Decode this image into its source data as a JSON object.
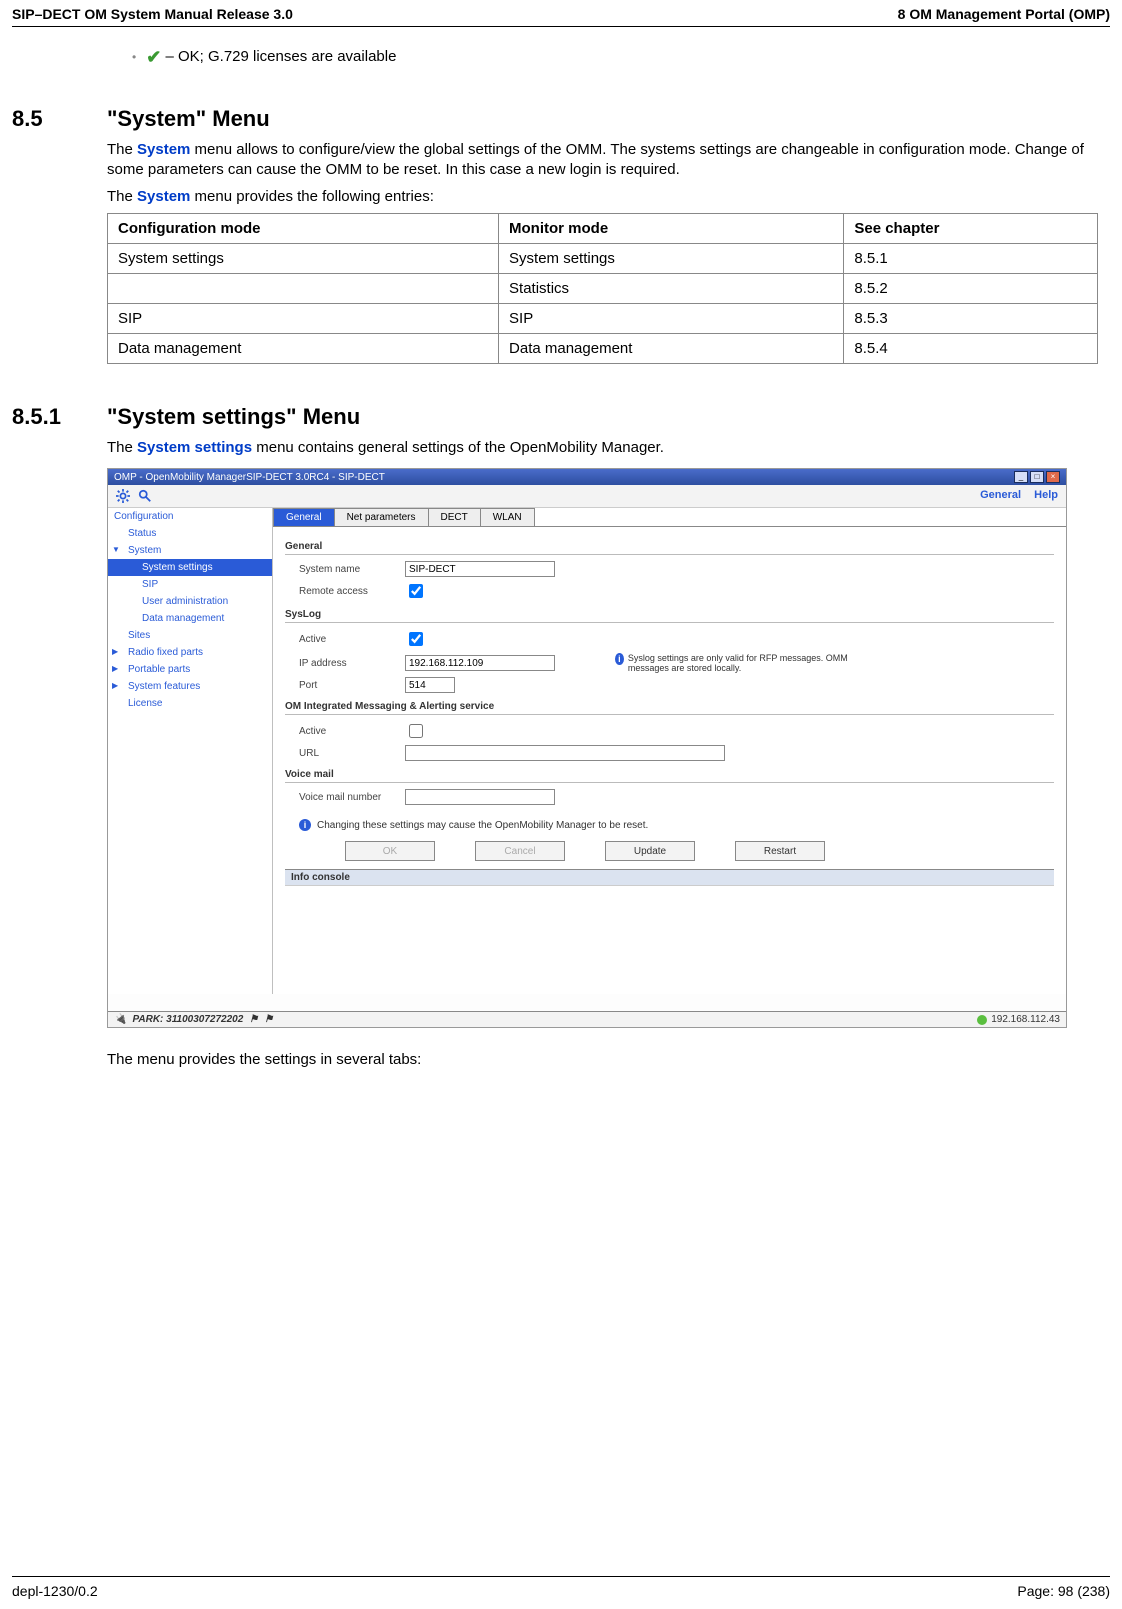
{
  "header": {
    "left": "SIP–DECT OM System Manual Release 3.0",
    "right": "8 OM Management Portal (OMP)"
  },
  "bullet": {
    "text": " – OK; G.729 licenses are available"
  },
  "sec85": {
    "num": "8.5",
    "title": "\"System\" Menu",
    "para1a": "The ",
    "para1b": "System",
    "para1c": " menu allows to configure/view the global settings of the OMM. The systems settings are changeable in configuration mode. Change of some parameters can cause the OMM to be reset. In this case a new login is required.",
    "para2a": "The ",
    "para2b": "System",
    "para2c": " menu provides the following entries:"
  },
  "table": {
    "head": [
      "Configuration mode",
      "Monitor mode",
      "See chapter"
    ],
    "rows": [
      [
        "System settings",
        "System settings",
        "8.5.1"
      ],
      [
        "",
        "Statistics",
        "8.5.2"
      ],
      [
        "SIP",
        "SIP",
        "8.5.3"
      ],
      [
        "Data management",
        "Data management",
        "8.5.4"
      ]
    ]
  },
  "sec851": {
    "num": "8.5.1",
    "title": "\"System settings\" Menu",
    "para1a": "The ",
    "para1b": "System settings",
    "para1c": " menu contains general settings of the OpenMobility Manager.",
    "after": "The menu provides the settings in several tabs:"
  },
  "screenshot": {
    "title": "OMP - OpenMobility ManagerSIP-DECT 3.0RC4 - SIP-DECT",
    "toolbar_links": [
      "General",
      "Help"
    ],
    "nav": {
      "configuration": "Configuration",
      "status": "Status",
      "system": "System",
      "system_settings": "System settings",
      "sip": "SIP",
      "user_admin": "User administration",
      "data_mgmt": "Data management",
      "sites": "Sites",
      "radio": "Radio fixed parts",
      "portable": "Portable parts",
      "features": "System features",
      "license": "License"
    },
    "tabs": [
      "General",
      "Net parameters",
      "DECT",
      "WLAN"
    ],
    "groups": {
      "general": "General",
      "syslog": "SysLog",
      "omima": "OM Integrated Messaging & Alerting service",
      "voicemail": "Voice mail"
    },
    "labels": {
      "system_name": "System name",
      "remote_access": "Remote access",
      "active": "Active",
      "ip": "IP address",
      "port": "Port",
      "url": "URL",
      "vm_number": "Voice mail number"
    },
    "values": {
      "system_name": "SIP-DECT",
      "ip": "192.168.112.109",
      "port": "514"
    },
    "notes": {
      "syslog": "Syslog settings are only valid for RFP messages. OMM messages are stored locally.",
      "warning": "Changing these settings may cause the OpenMobility Manager to be reset."
    },
    "buttons": [
      "OK",
      "Cancel",
      "Update",
      "Restart"
    ],
    "infoconsole": "Info console",
    "status_left": "PARK: 31100307272202",
    "status_right": "192.168.112.43"
  },
  "footer": {
    "left": "depl-1230/0.2",
    "right": "Page: 98 (238)"
  }
}
